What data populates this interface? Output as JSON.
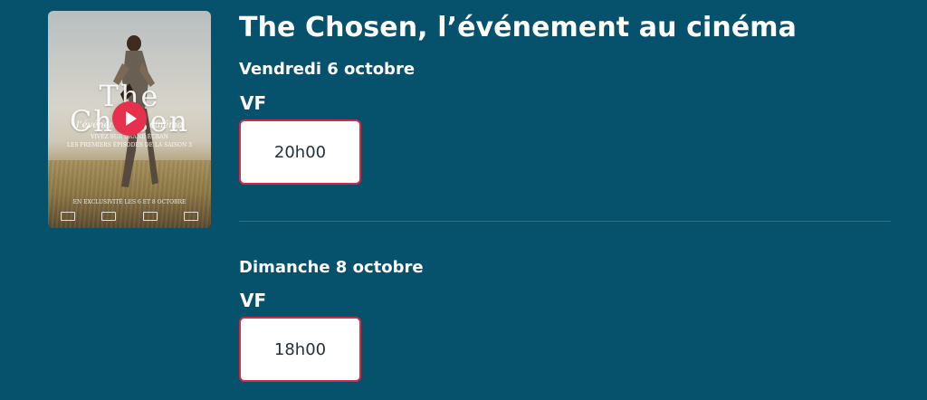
{
  "movie": {
    "title": "The Chosen, l’événement au cinéma",
    "poster": {
      "title_top": "The",
      "title_bottom": "Chosen",
      "subtitle": "l’événement au cinéma",
      "line_1": "VIVEZ SUR GRAND ÉCRAN",
      "line_2": "LES PREMIERS ÉPISODES DE LA SAISON 3",
      "release": "EN EXCLUSIVITÉ LES 6 ET 8 OCTOBRE",
      "play_icon": "play-icon",
      "logo_icons": [
        "logo-left-icon",
        "logo-center-icon",
        "logo-middle-icon",
        "logo-right-icon"
      ]
    }
  },
  "sessions": [
    {
      "day": "Vendredi 6 octobre",
      "version": "VF",
      "times": [
        "20h00"
      ]
    },
    {
      "day": "Dimanche 8 octobre",
      "version": "VF",
      "times": [
        "18h00"
      ]
    }
  ],
  "colors": {
    "background": "#06516b",
    "accent": "#d22a49",
    "play": "#e7304c",
    "button_bg": "#ffffff",
    "button_text": "#25313a"
  }
}
